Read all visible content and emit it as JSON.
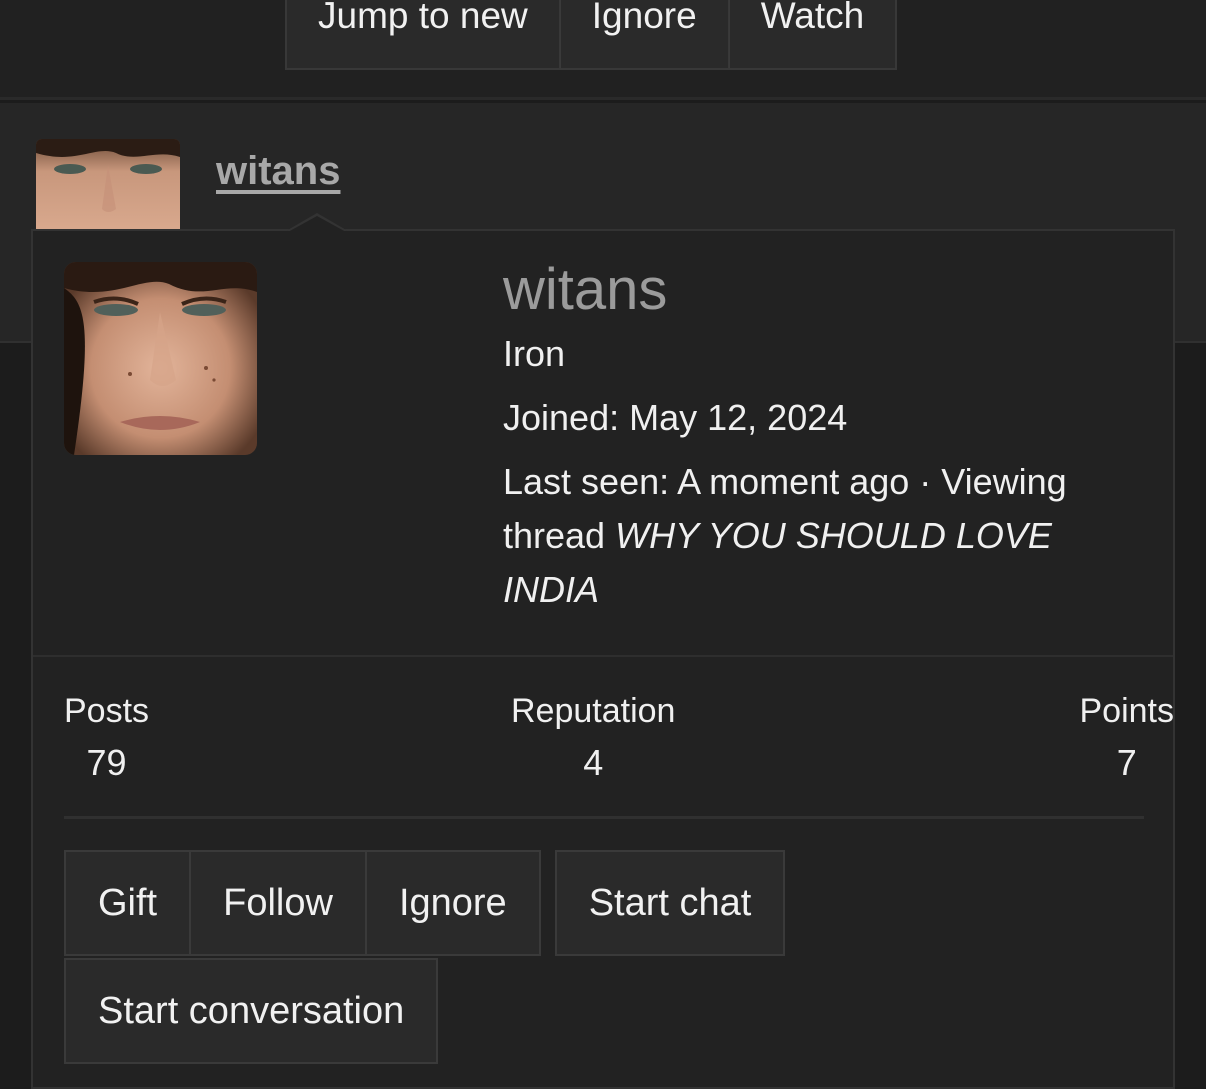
{
  "thread_actions": {
    "jump_to_new": "Jump to new",
    "ignore": "Ignore",
    "watch": "Watch"
  },
  "post": {
    "username": "witans"
  },
  "member_tooltip": {
    "username": "witans",
    "rank": "Iron",
    "joined_label": "Joined:",
    "joined_date": "May 12, 2024",
    "last_seen_label": "Last seen:",
    "last_seen_value": "A moment ago",
    "activity_prefix": "· Viewing thread",
    "activity_thread": "WHY YOU SHOULD LOVE INDIA",
    "stats": [
      {
        "label": "Posts",
        "value": "79"
      },
      {
        "label": "Reputation",
        "value": "4"
      },
      {
        "label": "Points",
        "value": "7"
      }
    ],
    "actions": {
      "gift": "Gift",
      "follow": "Follow",
      "ignore": "Ignore",
      "start_chat": "Start chat",
      "start_conversation": "Start conversation"
    }
  },
  "colors": {
    "background": "#1c1c1c",
    "panel": "#222222",
    "button": "#2a2a2a",
    "username_muted": "#9b9b9b"
  }
}
